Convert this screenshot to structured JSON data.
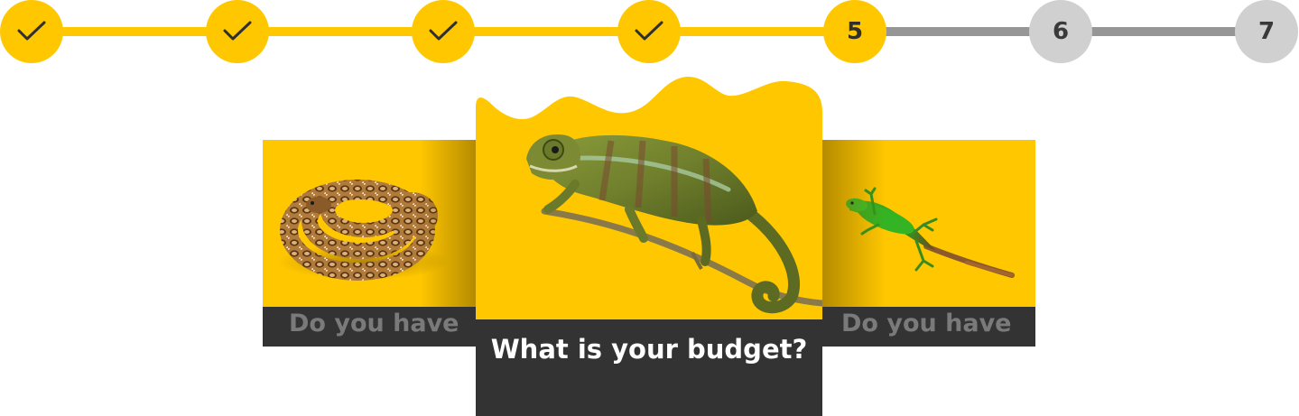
{
  "colors": {
    "accent": "#ffc700",
    "inactive_step": "#d0d0d0",
    "inactive_line": "#969696",
    "label_bar": "#333333"
  },
  "stepper": {
    "current_step": 5,
    "total_steps": 7,
    "steps": [
      {
        "state": "done",
        "icon": "check-icon"
      },
      {
        "state": "done",
        "icon": "check-icon"
      },
      {
        "state": "done",
        "icon": "check-icon"
      },
      {
        "state": "done",
        "icon": "check-icon"
      },
      {
        "state": "current",
        "label": "5"
      },
      {
        "state": "todo",
        "label": "6"
      },
      {
        "state": "todo",
        "label": "7"
      }
    ]
  },
  "cards": {
    "previous": {
      "label": "Do you have",
      "image": "python-snake"
    },
    "current": {
      "label": "What is your budget?",
      "image": "chameleon-on-branch"
    },
    "next": {
      "label": "Do you have",
      "image": "green-lizard"
    }
  }
}
